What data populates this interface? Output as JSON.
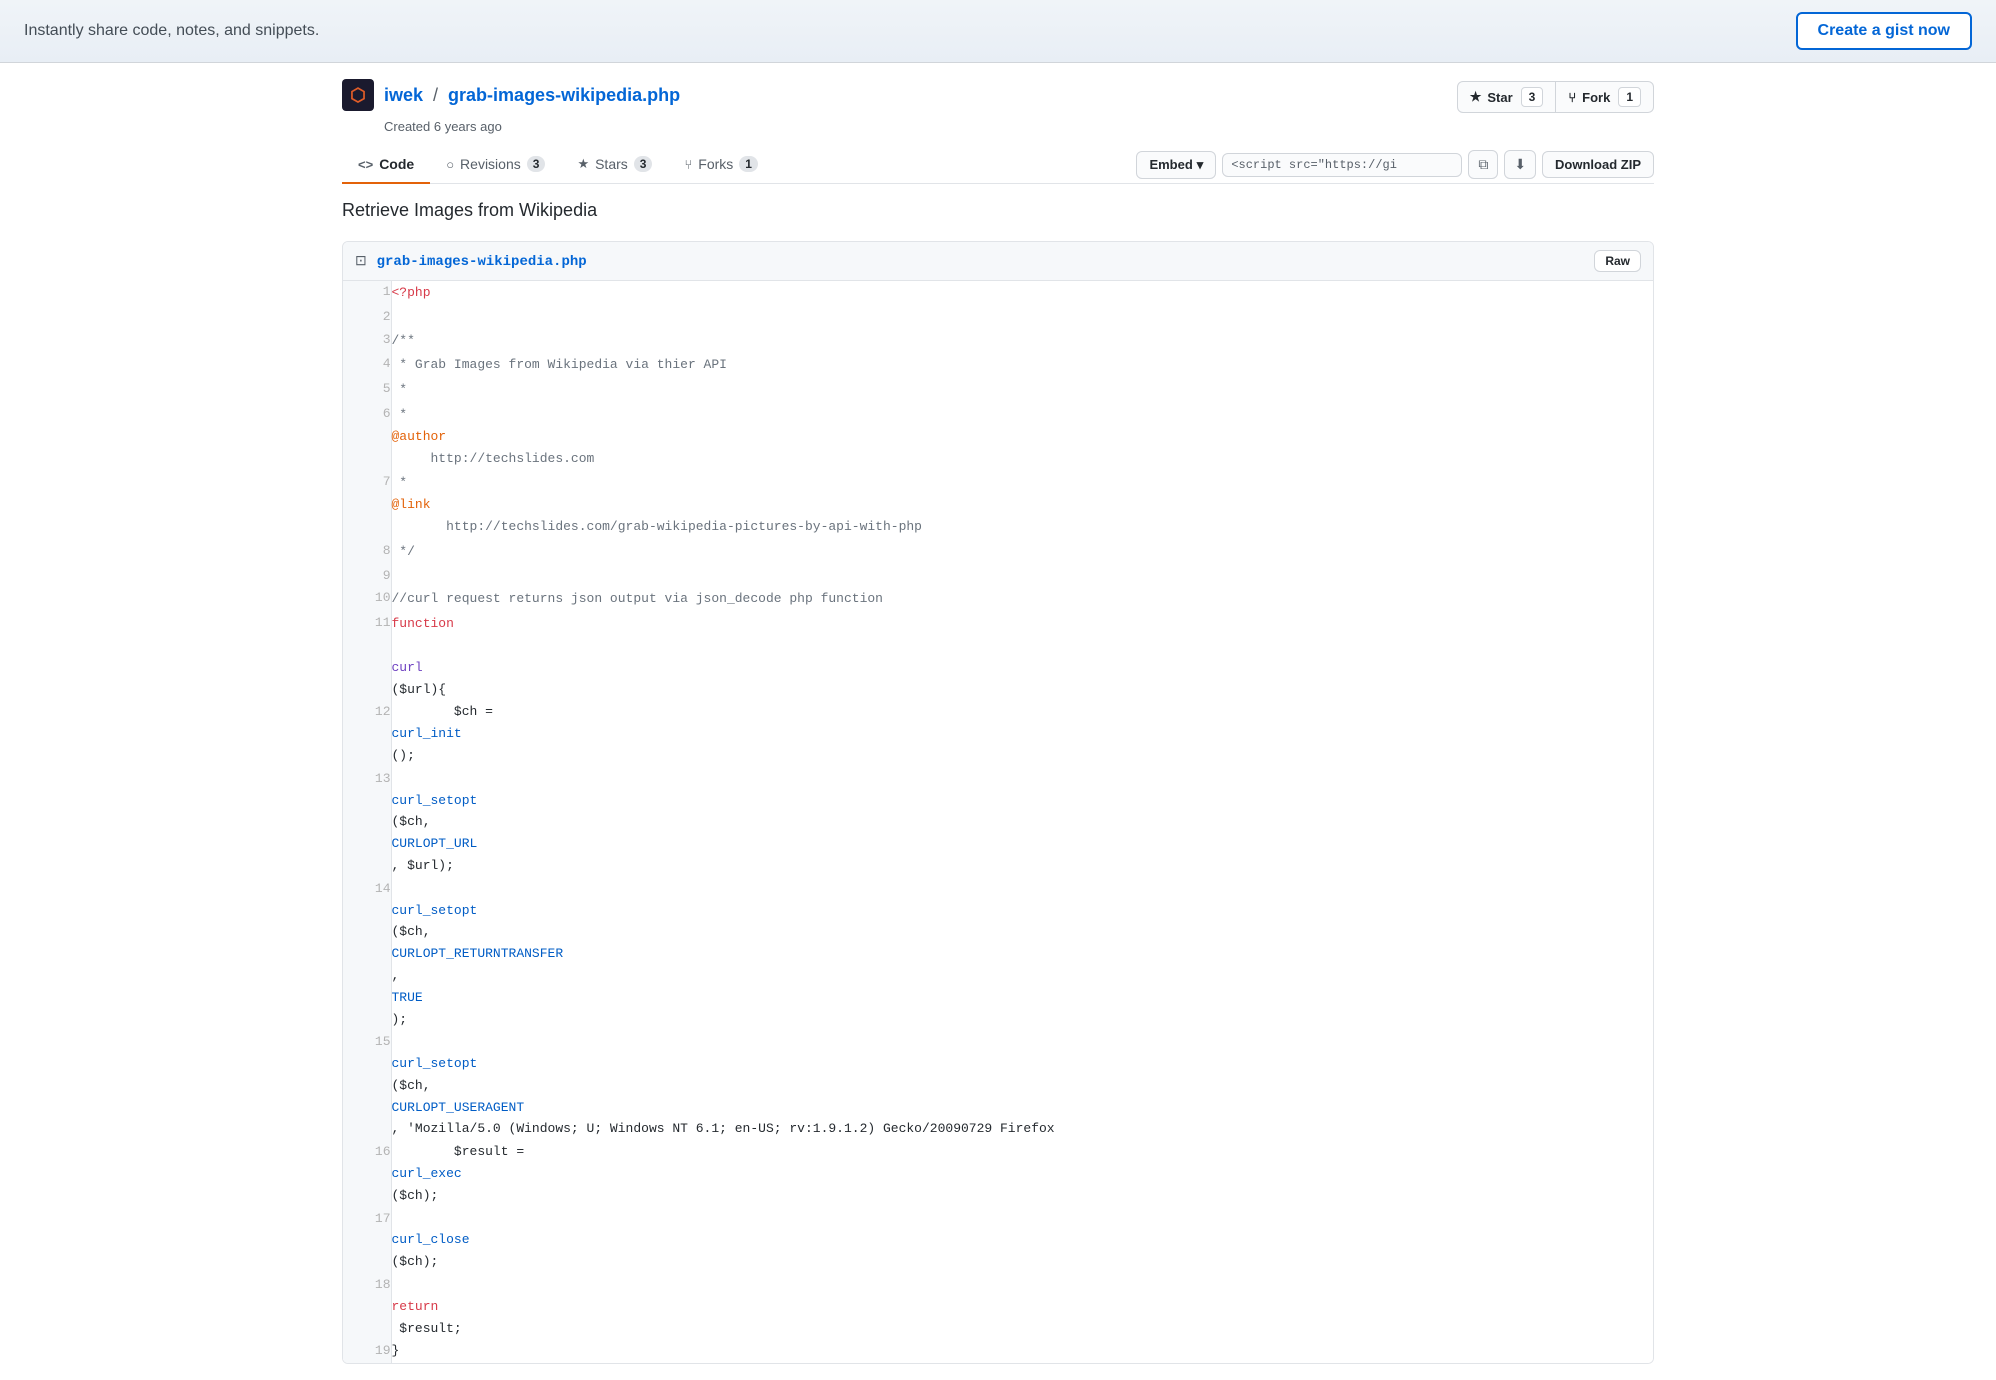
{
  "topbar": {
    "tagline": "Instantly share code, notes, and snippets.",
    "create_gist_label": "Create a gist now"
  },
  "gist": {
    "owner": "iwek",
    "separator": "/",
    "filename": "grab-images-wikipedia.php",
    "created": "Created 6 years ago",
    "description": "Retrieve Images from Wikipedia",
    "star_label": "Star",
    "star_count": "3",
    "fork_label": "Fork",
    "fork_count": "1"
  },
  "tabs": [
    {
      "id": "code",
      "icon": "<>",
      "label": "Code",
      "count": null,
      "active": true
    },
    {
      "id": "revisions",
      "icon": "○",
      "label": "Revisions",
      "count": "3",
      "active": false
    },
    {
      "id": "stars",
      "icon": "★",
      "label": "Stars",
      "count": "3",
      "active": false
    },
    {
      "id": "forks",
      "icon": "⑂",
      "label": "Forks",
      "count": "1",
      "active": false
    }
  ],
  "toolbar": {
    "embed_label": "Embed",
    "embed_value": "<script src=\"https://gi",
    "copy_tooltip": "Copy",
    "download_label": "Download ZIP"
  },
  "codefile": {
    "filename": "grab-images-wikipedia.php",
    "raw_label": "Raw",
    "lines": [
      {
        "num": "1",
        "code": "<?php"
      },
      {
        "num": "2",
        "code": ""
      },
      {
        "num": "3",
        "code": "/**"
      },
      {
        "num": "4",
        "code": " * Grab Images from Wikipedia via thier API"
      },
      {
        "num": "5",
        "code": " *"
      },
      {
        "num": "6",
        "code": " * @author     http://techslides.com"
      },
      {
        "num": "7",
        "code": " * @link       http://techslides.com/grab-wikipedia-pictures-by-api-with-php"
      },
      {
        "num": "8",
        "code": " */"
      },
      {
        "num": "9",
        "code": ""
      },
      {
        "num": "10",
        "code": "//curl request returns json output via json_decode php function"
      },
      {
        "num": "11",
        "code": "function curl($url){"
      },
      {
        "num": "12",
        "code": "        $ch = curl_init();"
      },
      {
        "num": "13",
        "code": "        curl_setopt($ch, CURLOPT_URL, $url);"
      },
      {
        "num": "14",
        "code": "        curl_setopt($ch, CURLOPT_RETURNTRANSFER, TRUE);"
      },
      {
        "num": "15",
        "code": "        curl_setopt($ch, CURLOPT_USERAGENT, 'Mozilla/5.0 (Windows; U; Windows NT 6.1; en-US; rv:1.9.1.2) Gecko/20090729 Firefox"
      },
      {
        "num": "16",
        "code": "        $result = curl_exec($ch);"
      },
      {
        "num": "17",
        "code": "        curl_close($ch);"
      },
      {
        "num": "18",
        "code": "        return $result;"
      },
      {
        "num": "19",
        "code": "}"
      }
    ]
  }
}
